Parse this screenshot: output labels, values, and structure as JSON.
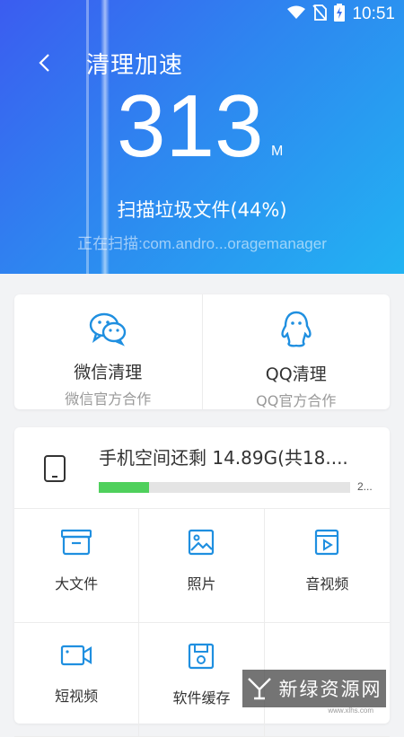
{
  "status_bar": {
    "time": "10:51",
    "icons": [
      "wifi-icon",
      "no-sim-icon",
      "battery-charging-icon"
    ]
  },
  "header": {
    "title": "清理加速",
    "junk_size": "313",
    "junk_unit": "M",
    "scan_status": "扫描垃圾文件(44%)",
    "scan_progress": 44,
    "scan_path": "正在扫描:com.andro...oragemanager"
  },
  "app_clean": [
    {
      "name": "微信清理",
      "sub": "微信官方合作",
      "icon": "wechat-icon"
    },
    {
      "name": "QQ清理",
      "sub": "QQ官方合作",
      "icon": "qq-icon"
    }
  ],
  "storage": {
    "text": "手机空间还剩 14.89G(共18....",
    "used_fraction": 0.2,
    "bar_label": "2...",
    "bar_color": "#4fd05c"
  },
  "categories": [
    {
      "label": "大文件",
      "icon": "large-file-icon"
    },
    {
      "label": "照片",
      "icon": "photo-icon"
    },
    {
      "label": "音视频",
      "icon": "video-file-icon"
    },
    {
      "label": "短视频",
      "icon": "short-video-icon"
    },
    {
      "label": "软件缓存",
      "icon": "app-cache-icon"
    },
    {
      "label": "",
      "icon": ""
    }
  ],
  "watermark": {
    "text": "新绿资源网",
    "sub": "www.xlhs.com"
  },
  "colors": {
    "accent": "#1f8fe0",
    "hero_start": "#3b5cf0",
    "hero_end": "#22b3f2"
  }
}
